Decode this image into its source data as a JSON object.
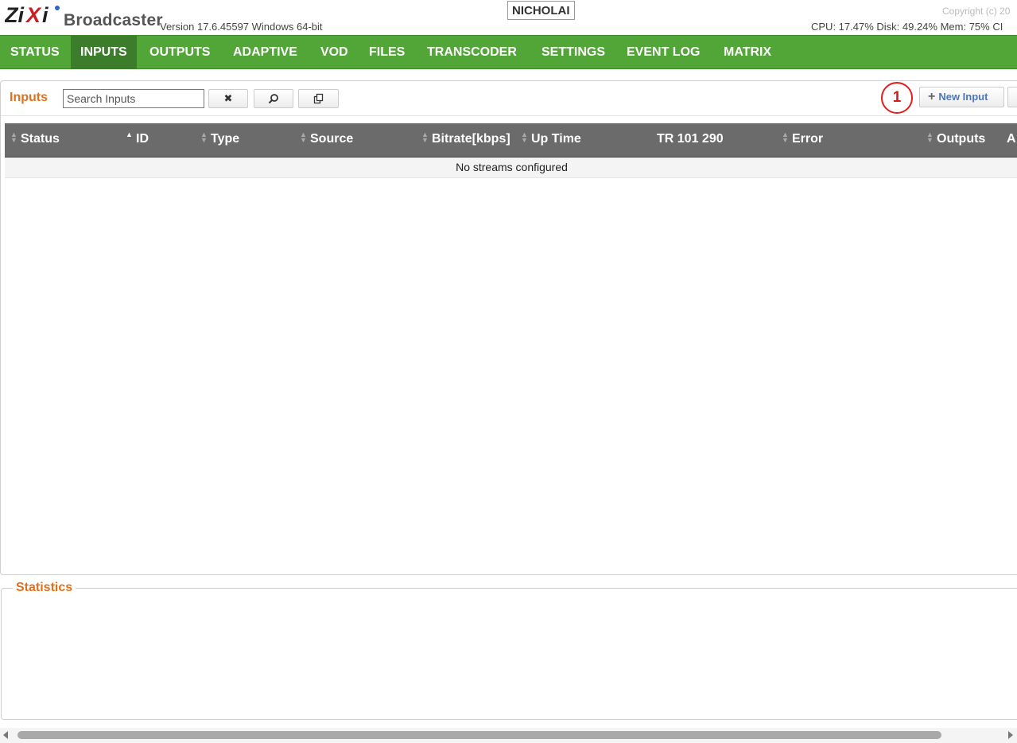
{
  "header": {
    "logo_icon": "zixi-logo",
    "brand": "Broadcaster",
    "version": "Version 17.6.45597 Windows 64-bit",
    "hostname": "NICHOLAI",
    "copyright": "Copyright (c) 20",
    "stats": "CPU: 17.47%  Disk: 49.24%  Mem: 75%  CI"
  },
  "nav": {
    "active": "INPUTS",
    "items": [
      "STATUS",
      "INPUTS",
      "OUTPUTS",
      "ADAPTIVE",
      "VOD",
      "FILES",
      "TRANSCODER",
      "SETTINGS",
      "EVENT LOG",
      "MATRIX"
    ]
  },
  "inputs_panel": {
    "title": "Inputs",
    "search_placeholder": "Search Inputs",
    "clear_icon": "close-icon",
    "search_icon": "magnifier-icon",
    "copy_icon": "copy-icon",
    "new_input_label": "New Input",
    "annotation_marker": "1"
  },
  "table": {
    "columns": [
      "Status",
      "ID",
      "Type",
      "Source",
      "Bitrate[kbps]",
      "Up Time",
      "TR 101 290",
      "Error",
      "Outputs",
      "A"
    ],
    "empty_message": "No streams configured"
  },
  "statistics": {
    "title": "Statistics"
  },
  "colors": {
    "nav_green": "#52a637",
    "nav_active": "#3b7d2a",
    "accent_orange": "#e1701d",
    "table_header": "#6b6b6b",
    "link_blue": "#4a76c3",
    "annotation_red": "#e02020"
  }
}
